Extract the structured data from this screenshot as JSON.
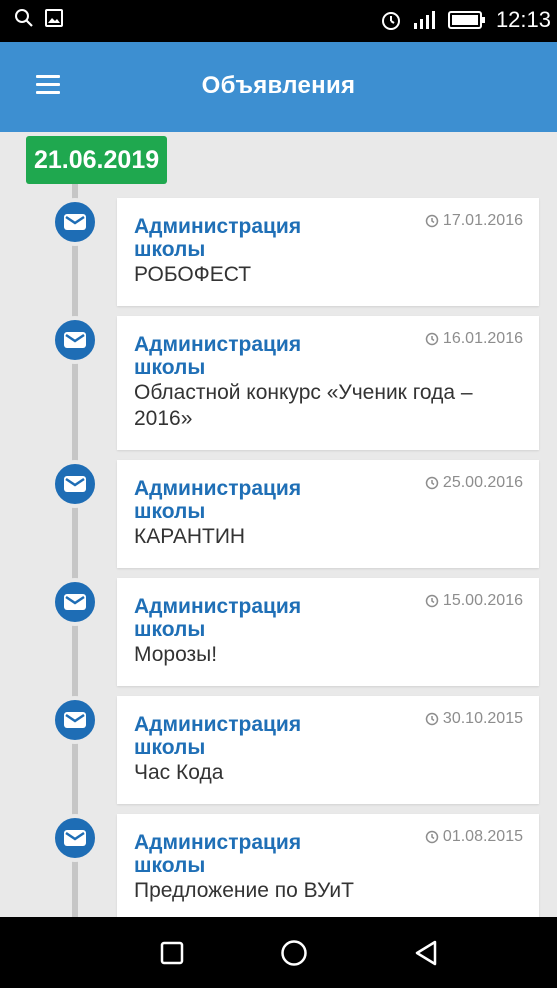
{
  "status_bar": {
    "time": "12:13"
  },
  "app_bar": {
    "title": "Объявления"
  },
  "date_group": "21.06.2019",
  "announcements": [
    {
      "author": "Администрация школы",
      "date": "17.01.2016",
      "subject": "РОБОФЕСТ"
    },
    {
      "author": "Администрация школы",
      "date": "16.01.2016",
      "subject": "Областной конкурс «Ученик года – 2016»"
    },
    {
      "author": "Администрация школы",
      "date": "25.00.2016",
      "subject": "КАРАНТИН"
    },
    {
      "author": "Администрация школы",
      "date": "15.00.2016",
      "subject": "Морозы!"
    },
    {
      "author": "Администрация школы",
      "date": "30.10.2015",
      "subject": "Час Кода"
    },
    {
      "author": "Администрация школы",
      "date": "01.08.2015",
      "subject": "Предложение по ВУиТ"
    }
  ],
  "colors": {
    "app_bar": "#3d8fd1",
    "date_badge": "#1fa84f",
    "marker": "#1e6db5",
    "author_text": "#1f6fb6"
  },
  "icons": {
    "menu": "hamburger-menu-icon",
    "marker": "envelope-icon",
    "date": "clock-icon",
    "nav_recents": "square-icon",
    "nav_home": "circle-icon",
    "nav_back": "triangle-back-icon"
  }
}
